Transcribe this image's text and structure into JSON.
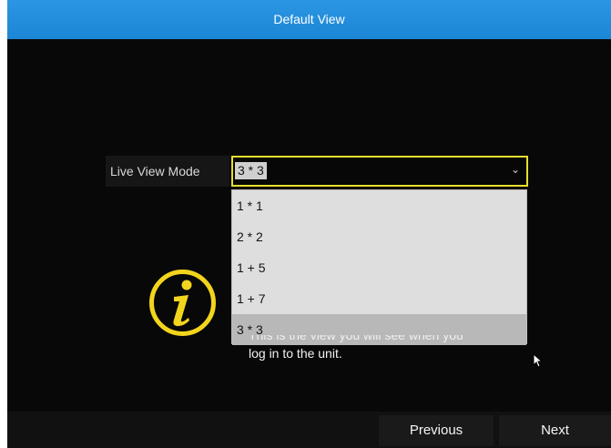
{
  "window": {
    "title": "Default View"
  },
  "live_view": {
    "label": "Live View Mode",
    "selected_value": "3 * 3",
    "options": [
      "1 * 1",
      "2 * 2",
      "1 + 5",
      "1 + 7",
      "3 * 3"
    ],
    "selected_index": 4
  },
  "hint": {
    "icon": "info-icon",
    "line1": "This is the view you will see when you",
    "line2": "log in to the unit."
  },
  "footer": {
    "previous_label": "Previous",
    "next_label": "Next"
  },
  "colors": {
    "title_bar": "#2290df",
    "focus_border": "#e5de2e",
    "background": "#080808"
  }
}
